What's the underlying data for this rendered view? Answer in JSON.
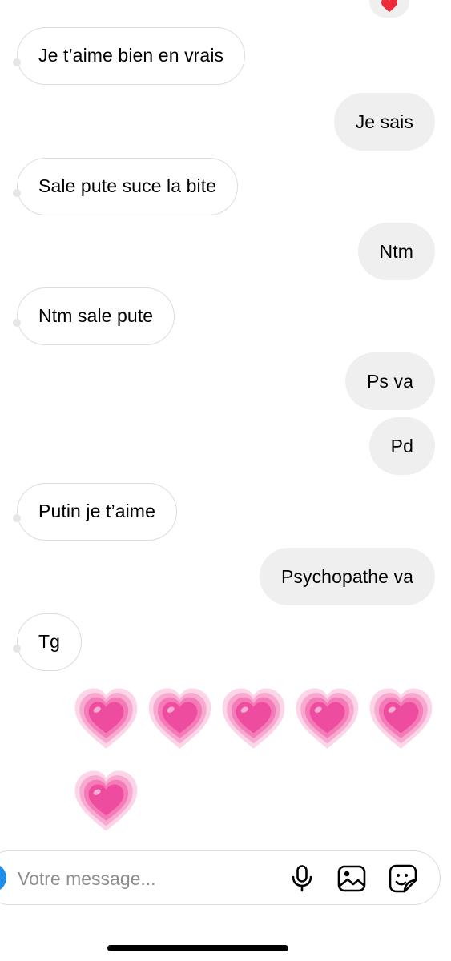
{
  "conversation": {
    "top_reaction": "heart",
    "messages": [
      {
        "direction": "in",
        "text": "Je t’aime bien en vrais"
      },
      {
        "direction": "out",
        "text": "Je sais"
      },
      {
        "direction": "in",
        "text": "Sale pute suce la bite"
      },
      {
        "direction": "out",
        "text": "Ntm"
      },
      {
        "direction": "in",
        "text": "Ntm sale pute"
      },
      {
        "direction": "out",
        "text": "Ps va"
      },
      {
        "direction": "out",
        "text": "Pd"
      },
      {
        "direction": "in",
        "text": "Putin je t’aime"
      },
      {
        "direction": "out",
        "text": "Psychopathe va"
      },
      {
        "direction": "in",
        "text": "Tg"
      }
    ],
    "emoji_message": {
      "emoji": "growing-heart",
      "count": 6
    }
  },
  "composer": {
    "placeholder": "Votre message...",
    "icons": [
      "camera-icon",
      "microphone-icon",
      "gallery-icon",
      "sticker-icon"
    ]
  },
  "colors": {
    "incoming_bg": "#ffffff",
    "incoming_border": "#dcdcdc",
    "outgoing_bg": "#efefef",
    "heart_pink": "#f0509e",
    "accent_blue": "#1e8fea",
    "placeholder": "#8e8e8e"
  }
}
